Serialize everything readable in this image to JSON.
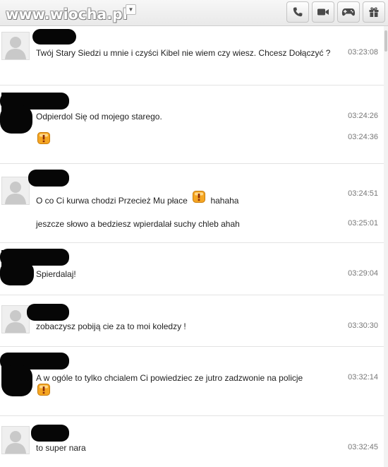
{
  "watermark": "www.wiocha.pl",
  "toolbar": {
    "icons": [
      "phone-icon",
      "video-camera-icon",
      "gamepad-icon",
      "gift-icon"
    ]
  },
  "emoticon": {
    "name": "angry-emoticon-icon",
    "color": "#f5a623"
  },
  "colors": {
    "timestamp": "#777777",
    "separator": "#e3e3e3",
    "redaction": "#060606"
  },
  "messages": [
    {
      "lines": [
        {
          "text": "Twój Stary Siedzi u mnie i czyści Kibel nie wiem czy wiesz. Chcesz Dołączyć ?",
          "time": "03:23:08"
        }
      ]
    },
    {
      "lines": [
        {
          "text": "Odpierdol Się od mojego starego.",
          "time": "03:24:26"
        },
        {
          "text": "",
          "time": "03:24:36"
        }
      ]
    },
    {
      "lines": [
        {
          "text_before": "O co Ci kurwa chodzi Przecież Mu płace",
          "text_after": "hahaha",
          "time": "03:24:51"
        },
        {
          "text": "jeszcze słowo a bedziesz wpierdalał suchy chleb ahah",
          "time": "03:25:01"
        }
      ]
    },
    {
      "lines": [
        {
          "text": "Spierdalaj!",
          "time": "03:29:04"
        }
      ]
    },
    {
      "lines": [
        {
          "text": "zobaczysz pobiją cie za to moi koledzy !",
          "time": "03:30:30"
        }
      ]
    },
    {
      "lines": [
        {
          "text": "A w ogóle to tylko chcialem Ci powiedziec ze jutro zadzwonie na policje",
          "time": "03:32:14"
        }
      ]
    },
    {
      "lines": [
        {
          "text": "to super nara",
          "time": "03:32:45"
        }
      ]
    }
  ]
}
